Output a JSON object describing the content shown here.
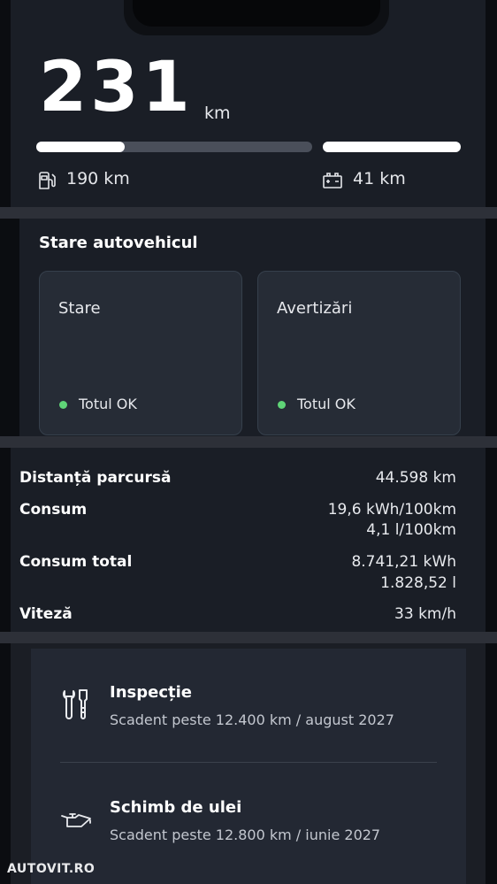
{
  "range": {
    "total_value": "231",
    "total_unit": "km",
    "fuel_km": "190 km",
    "electric_km": "41 km",
    "fuel_level_fraction": 0.32,
    "battery_level_fraction": 1.0
  },
  "vehicle_status": {
    "title": "Stare autovehicul",
    "tiles": [
      {
        "label": "Stare",
        "status": "Totul OK"
      },
      {
        "label": "Avertizări",
        "status": "Totul OK"
      }
    ]
  },
  "stats": [
    {
      "label": "Distanță parcursă",
      "values": [
        "44.598 km"
      ]
    },
    {
      "label": "Consum",
      "values": [
        "19,6 kWh/100km",
        "4,1 l/100km"
      ]
    },
    {
      "label": "Consum total",
      "values": [
        "8.741,21 kWh",
        "1.828,52 l"
      ]
    },
    {
      "label": "Viteză",
      "values": [
        "33 km/h"
      ]
    }
  ],
  "service": [
    {
      "title": "Inspecție",
      "subtitle": "Scadent peste 12.400 km / august 2027",
      "icon": "wrench-screwdriver-icon"
    },
    {
      "title": "Schimb de ulei",
      "subtitle": "Scadent peste 12.800 km / iunie 2027",
      "icon": "oil-can-icon"
    }
  ],
  "watermark": "AUTOVIT.RO",
  "colors": {
    "ok_dot": "#5fd477",
    "card_bg": "#1a1e26",
    "tile_bg": "#262c36"
  }
}
